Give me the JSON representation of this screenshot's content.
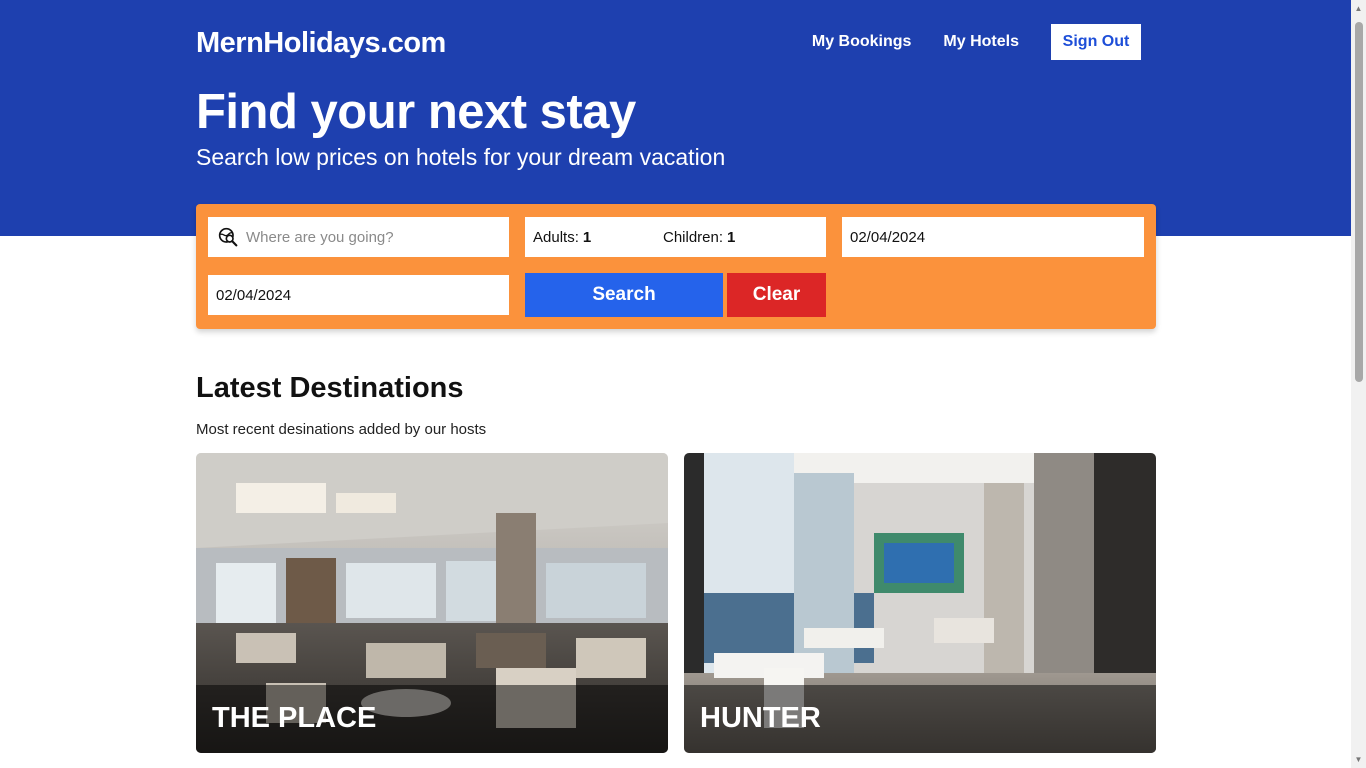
{
  "header": {
    "brand": "MernHolidays.com",
    "nav": {
      "my_bookings": "My Bookings",
      "my_hotels": "My Hotels",
      "sign_out": "Sign Out"
    },
    "hero_title": "Find your next stay",
    "hero_subtitle": "Search low prices on hotels for your dream vacation"
  },
  "search": {
    "destination_placeholder": "Where are you going?",
    "adults_label": "Adults:",
    "adults_value": "1",
    "children_label": "Children:",
    "children_value": "1",
    "check_in": "02/04/2024",
    "check_out": "02/04/2024",
    "search_label": "Search",
    "clear_label": "Clear",
    "icon": "globe-search-icon"
  },
  "destinations": {
    "title": "Latest Destinations",
    "subtitle": "Most recent desinations added by our hosts",
    "items": [
      {
        "name": "THE PLACE"
      },
      {
        "name": "HUNTER"
      }
    ]
  },
  "colors": {
    "header_bg": "#1e40af",
    "search_bg": "#fb923c",
    "search_button": "#2563eb",
    "clear_button": "#dc2626"
  }
}
